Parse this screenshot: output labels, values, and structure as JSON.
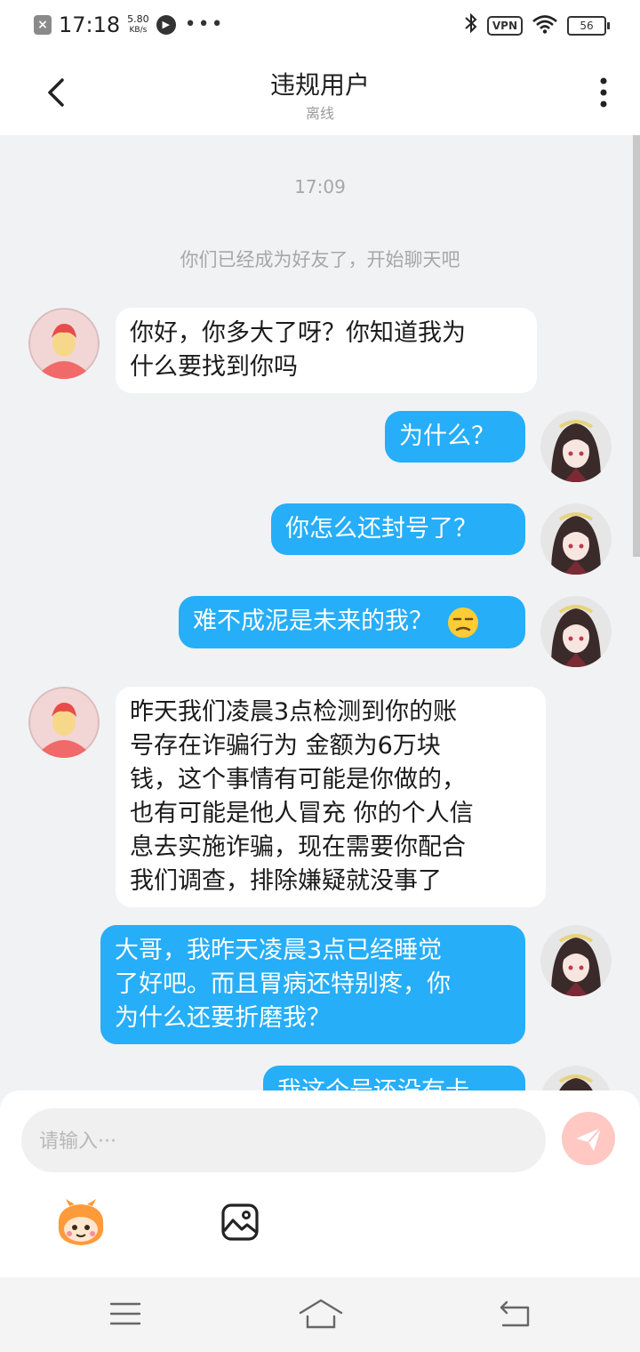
{
  "status_bar": {
    "time": "17:18",
    "speed_value": "5.80",
    "speed_unit": "KB/s",
    "more": "•••",
    "vpn": "VPN",
    "battery": "56"
  },
  "header": {
    "title": "违规用户",
    "subtitle": "离线"
  },
  "chat": {
    "timestamp": "17:09",
    "system_message": "你们已经成为好友了，开始聊天吧",
    "messages": [
      {
        "from": "other",
        "lines": [
          "你好，你多大了呀？你知道我为",
          "什么要找到你吗"
        ]
      },
      {
        "from": "me",
        "lines": [
          "为什么？"
        ]
      },
      {
        "from": "me",
        "lines": [
          "你怎么还封号了？"
        ]
      },
      {
        "from": "me",
        "lines": [
          "难不成泥是未来的我？"
        ],
        "emoji": "unamused-face"
      },
      {
        "from": "other",
        "lines": [
          "昨天我们凌晨3点检测到你的账",
          "号存在诈骗行为 金额为6万块",
          "钱，这个事情有可能是你做的，",
          "也有可能是他人冒充 你的个人信",
          "息去实施诈骗，现在需要你配合",
          "我们调查，排除嫌疑就没事了"
        ]
      },
      {
        "from": "me",
        "lines": [
          "大哥，我昨天凌晨3点已经睡觉",
          "了好吧。而且胃病还特别疼，你",
          "为什么还要折磨我？"
        ]
      },
      {
        "from": "me",
        "lines": [
          "我这个号还没有卡"
        ]
      }
    ]
  },
  "composer": {
    "placeholder": "请输入···"
  },
  "colors": {
    "outgoing_bubble": "#26aef8",
    "incoming_bubble": "#ffffff",
    "chat_background": "#f1f2f4",
    "send_button": "#ffc8c2"
  }
}
